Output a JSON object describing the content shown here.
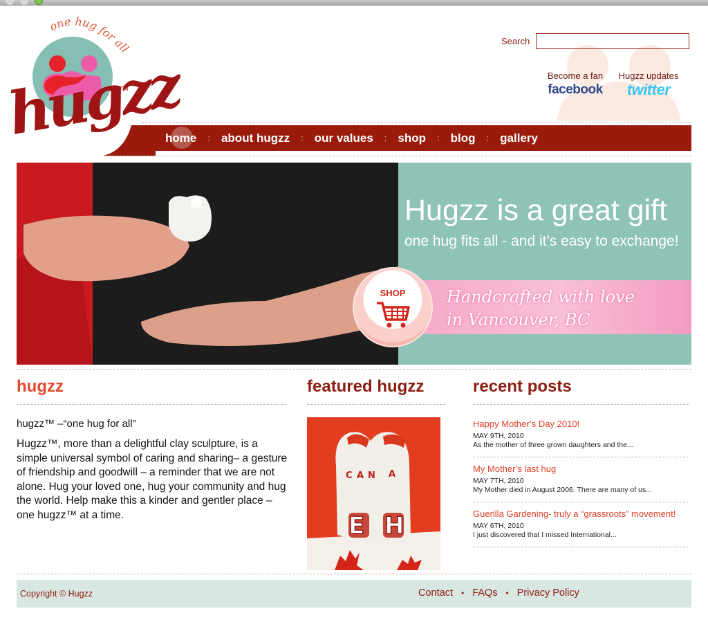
{
  "header": {
    "logo": {
      "tagline": "one hug for all",
      "wordmark": "hugzz",
      "trademark": "TM"
    },
    "search": {
      "label": "Search",
      "value": "",
      "placeholder": ""
    },
    "social": [
      {
        "caption": "Become a fan",
        "brand": "facebook",
        "icon": "facebook-logo"
      },
      {
        "caption": "Hugzz updates",
        "brand": "twitter",
        "icon": "twitter-logo"
      }
    ]
  },
  "nav": {
    "items": [
      "home",
      "about hugzz",
      "our values",
      "shop",
      "blog",
      "gallery"
    ],
    "separator": ":",
    "active": "home"
  },
  "hero": {
    "title": "Hugzz is a great gift",
    "subtitle": "one hug fits all - and it’s easy to exchange!",
    "band_line1": "Handcrafted with love",
    "band_line2": "in Vancouver, BC",
    "shop_label": "SHOP",
    "shop_icon": "shopping-cart-icon"
  },
  "about": {
    "title": "hugzz",
    "heading": "hugzz™ –“one hug for all”",
    "body": "Hugzz™, more than a delightful clay sculpture, is a simple universal symbol of caring and sharing– a gesture of friendship and goodwill – a reminder that we are not alone. Hug your loved one, hug your community and hug the world. Help make this a kinder and gentler place – one hugzz™ at a time."
  },
  "featured": {
    "title": "featured hugzz",
    "image_letters": [
      "C",
      "A",
      "N",
      "A",
      "E",
      "H"
    ]
  },
  "recent": {
    "title": "recent posts",
    "posts": [
      {
        "title": "Happy Mother’s Day 2010!",
        "date": "MAY 9TH, 2010",
        "excerpt": "As the mother of three grown daughters and the..."
      },
      {
        "title": "My Mother’s last hug",
        "date": "MAY 7TH, 2010",
        "excerpt": "My Mother died in August 2006. There are many of us..."
      },
      {
        "title": "Guerilla Gardening- truly a “grassroots” movement!",
        "date": "MAY 6TH, 2010",
        "excerpt": "I just discovered that I missed International..."
      }
    ]
  },
  "footer": {
    "copyright": "Copyright © Hugzz",
    "links": [
      "Contact",
      "FAQs",
      "Privacy Policy"
    ],
    "separator": "•"
  },
  "colors": {
    "brand_red": "#9a1b0c",
    "accent_orange": "#e34a2c",
    "teal": "#8fc3b6",
    "pink": "#f5a7c9",
    "footer_bg": "#d9e7e2"
  }
}
